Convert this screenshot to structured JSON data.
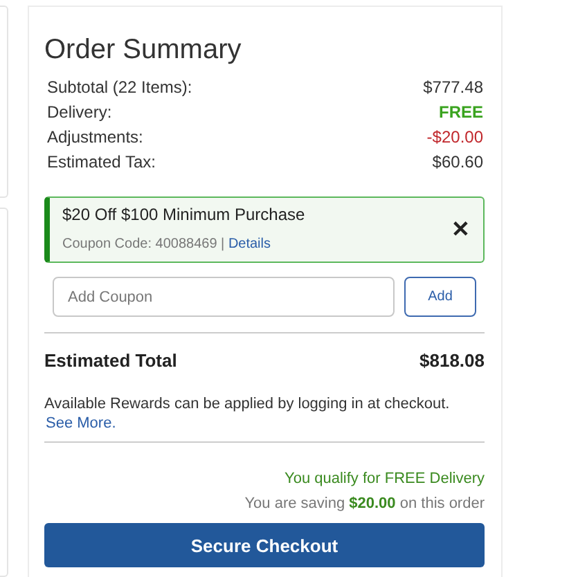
{
  "order_summary": {
    "title": "Order Summary",
    "lines": [
      {
        "label": "Subtotal (22 Items):",
        "value": "$777.48",
        "kind": "plain"
      },
      {
        "label": "Delivery:",
        "value": "FREE",
        "kind": "free"
      },
      {
        "label": "Adjustments:",
        "value": "-$20.00",
        "kind": "discount"
      },
      {
        "label": "Estimated Tax:",
        "value": "$60.60",
        "kind": "plain"
      }
    ],
    "applied_coupon": {
      "title": "$20 Off $100 Minimum Purchase",
      "code": "Coupon Code: 40088469",
      "separator": "|",
      "link": "Details",
      "remove": "✕"
    },
    "coupon_field": {
      "placeholder": "Add Coupon",
      "button": "Add"
    },
    "total": {
      "label": "Estimated Total",
      "value": "$818.08"
    },
    "rewards": {
      "text": "Available Rewards can be applied by logging in at checkout.",
      "link": "See More."
    },
    "delivery_note": "You qualify for FREE Delivery",
    "saving_note": "You are saving **$20.00** on this order",
    "checkout_button": "Secure Checkout"
  }
}
